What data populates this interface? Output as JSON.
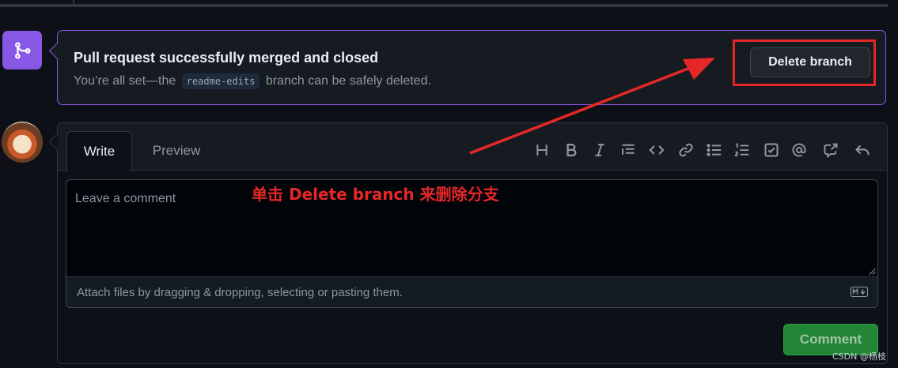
{
  "merge": {
    "title": "Pull request successfully merged and closed",
    "desc_prefix": "You’re all set—the",
    "branch": "readme-edits",
    "desc_suffix": "branch can be safely deleted.",
    "button_label": "Delete branch",
    "icon": "git-merge-icon"
  },
  "comment": {
    "tabs": [
      {
        "label": "Write",
        "active": true
      },
      {
        "label": "Preview",
        "active": false
      }
    ],
    "toolbar": [
      "heading-icon",
      "bold-icon",
      "italic-icon",
      "quote-icon",
      "code-icon",
      "link-icon",
      "unordered-list-icon",
      "ordered-list-icon",
      "task-list-icon",
      "mention-icon",
      "cross-reference-icon",
      "reply-icon"
    ],
    "placeholder": "Leave a comment",
    "attach_text": "Attach files by dragging & dropping, selecting or pasting them.",
    "submit_label": "Comment"
  },
  "annotation": {
    "text": "单击 Delete branch 来删除分支",
    "color": "#e62727"
  },
  "watermark": "CSDN @杨枝",
  "colors": {
    "merged_purple": "#8957e5",
    "success_green": "#238636",
    "background": "#0d1117"
  }
}
